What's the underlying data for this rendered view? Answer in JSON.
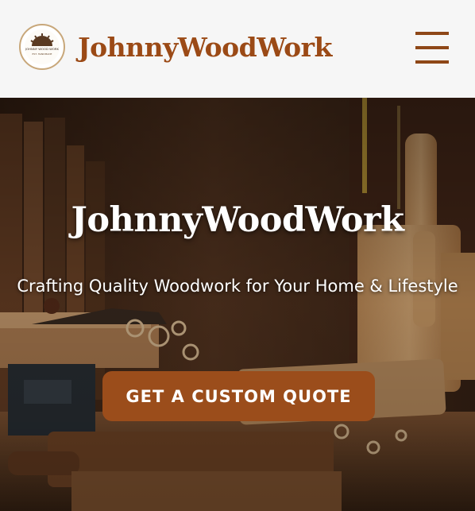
{
  "header": {
    "brand": "JohnnyWoodWork",
    "logo_text_top": "JOHNNY WOOD WORK",
    "logo_text_bottom": "EST. HANDMADE",
    "menu_icon": "hamburger-icon"
  },
  "hero": {
    "title": "JohnnyWoodWork",
    "subtitle": "Crafting Quality Woodwork for Your Home & Lifestyle",
    "cta_label": "GET A CUSTOM QUOTE"
  },
  "colors": {
    "brand": "#9b4a16",
    "cta_bg": "#9b4d1b",
    "header_bg": "#f6f6f6"
  }
}
